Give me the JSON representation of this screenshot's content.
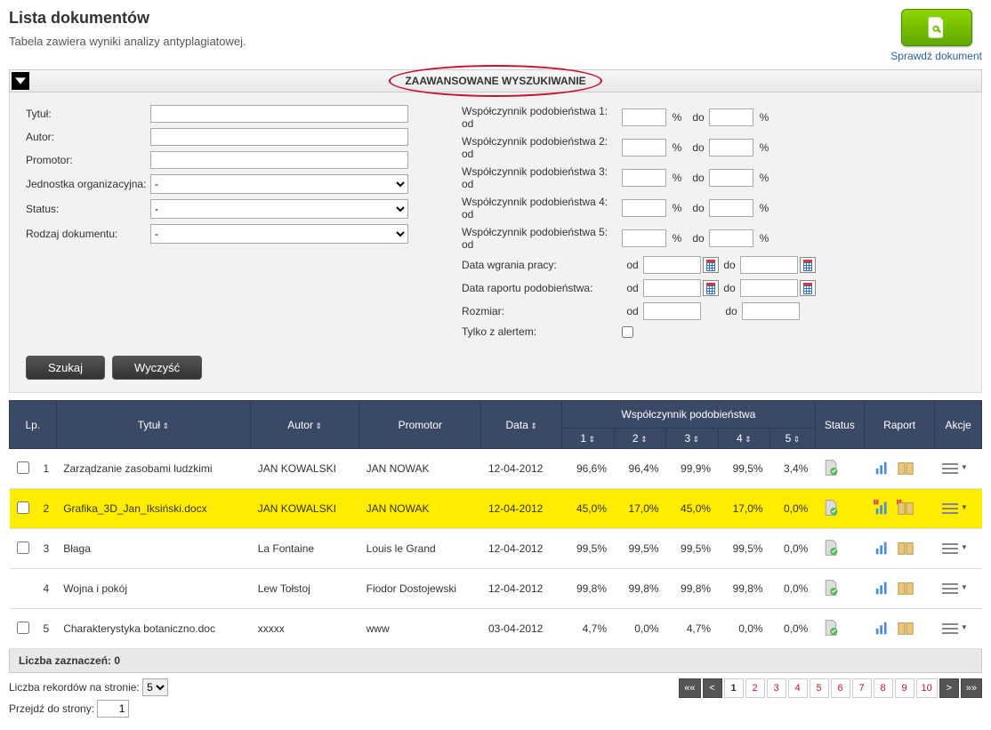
{
  "header": {
    "title": "Lista dokumentów",
    "subtitle": "Tabela zawiera wyniki analizy antyplagiatowej.",
    "check_label": "Sprawdź dokument"
  },
  "adv": {
    "heading": "ZAAWANSOWANE WYSZUKIWANIE",
    "left": {
      "tytul": "Tytuł:",
      "autor": "Autor:",
      "promotor": "Promotor:",
      "jednostka": "Jednostka organizacyjna:",
      "status": "Status:",
      "rodzaj": "Rodzaj dokumentu:",
      "dash": "-"
    },
    "right": {
      "wp": "Współczynnik podobieństwa",
      "od": "od",
      "do": "do",
      "pct": "%",
      "data_wgrania": "Data wgrania pracy:",
      "data_raportu": "Data raportu podobieństwa:",
      "rozmiar": "Rozmiar:",
      "tylko_alert": "Tylko z alertem:"
    },
    "btn_search": "Szukaj",
    "btn_clear": "Wyczyść"
  },
  "table": {
    "head": {
      "lp": "Lp.",
      "tytul": "Tytuł",
      "autor": "Autor",
      "promotor": "Promotor",
      "data": "Data",
      "wp": "Współczynnik podobieństwa",
      "c1": "1",
      "c2": "2",
      "c3": "3",
      "c4": "4",
      "c5": "5",
      "status": "Status",
      "raport": "Raport",
      "akcje": "Akcje"
    },
    "rows": [
      {
        "lp": "1",
        "chk": true,
        "title": "Zarządzanie zasobami ludzkimi",
        "author": "JAN KOWALSKI",
        "promotor": "JAN NOWAK",
        "date": "12-04-2012",
        "wp": [
          "96,6%",
          "96,4%",
          "99,9%",
          "99,5%",
          "3,4%"
        ],
        "status": "ok",
        "rep": "normal",
        "hl": false
      },
      {
        "lp": "2",
        "chk": true,
        "title": "Grafika_3D_Jan_Iksiński.docx",
        "author": "JAN KOWALSKI",
        "promotor": "JAN NOWAK",
        "date": "12-04-2012",
        "wp": [
          "45,0%",
          "17,0%",
          "45,0%",
          "17,0%",
          "0,0%"
        ],
        "status": "ok",
        "rep": "alert",
        "hl": true
      },
      {
        "lp": "3",
        "chk": true,
        "title": "Błaga",
        "author": "La Fontaine",
        "promotor": "Louis le Grand",
        "date": "12-04-2012",
        "wp": [
          "99,5%",
          "99,5%",
          "99,5%",
          "99,5%",
          "0,0%"
        ],
        "status": "ok",
        "rep": "normal",
        "hl": false
      },
      {
        "lp": "4",
        "chk": false,
        "title": "Wojna i pokój",
        "author": "Lew Tołstoj",
        "promotor": "Fiodor Dostojewski",
        "date": "12-04-2012",
        "wp": [
          "99,8%",
          "99,8%",
          "99,8%",
          "99,8%",
          "0,0%"
        ],
        "status": "add",
        "rep": "normal",
        "hl": false
      },
      {
        "lp": "5",
        "chk": true,
        "title": "Charakterystyka botaniczno.doc",
        "author": "xxxxx",
        "promotor": "www",
        "date": "03-04-2012",
        "wp": [
          "4,7%",
          "0,0%",
          "4,7%",
          "0,0%",
          "0,0%"
        ],
        "status": "ok",
        "rep": "normal",
        "hl": false
      }
    ],
    "selected": "Liczba zaznaczeń: 0"
  },
  "footer": {
    "records_label": "Liczba rekordów na stronie:",
    "records_value": "5",
    "goto_label": "Przejdź do strony:",
    "goto_value": "1",
    "pages": [
      "1",
      "2",
      "3",
      "4",
      "5",
      "6",
      "7",
      "8",
      "9",
      "10"
    ],
    "first": "««",
    "prev": "<",
    "next": ">",
    "last": "»»"
  }
}
